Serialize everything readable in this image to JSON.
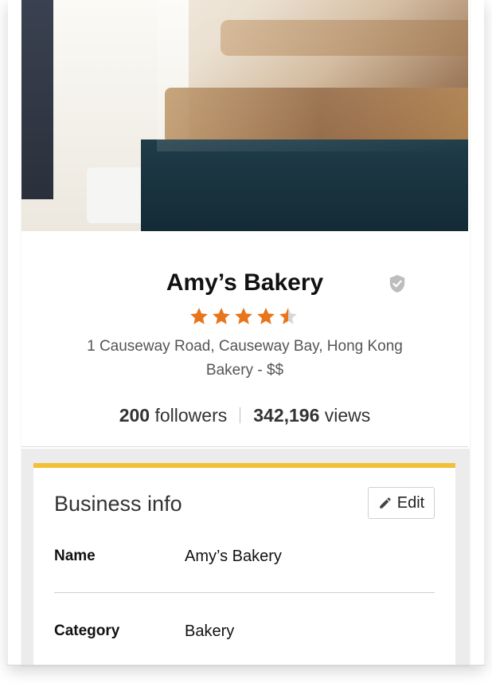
{
  "business": {
    "name": "Amy’s Bakery",
    "rating": 4.5,
    "rating_max": 5,
    "address": "1 Causeway Road, Causeway Bay, Hong Kong",
    "category_price": "Bakery - $$"
  },
  "stats": {
    "followers_count": "200",
    "followers_label": " followers",
    "views_count": "342,196",
    "views_label": " views"
  },
  "business_info": {
    "title": "Business info",
    "edit_label": "Edit",
    "rows": [
      {
        "label": "Name",
        "value": "Amy’s Bakery"
      },
      {
        "label": "Category",
        "value": "Bakery"
      }
    ]
  },
  "colors": {
    "star": "#e8751a",
    "star_empty": "#d6d6d6",
    "accent_bar": "#f2c037",
    "shield": "#bdbdbd"
  },
  "icons": {
    "verified": "shield-check-icon",
    "edit": "pencil-icon",
    "rating": "star-icon"
  }
}
